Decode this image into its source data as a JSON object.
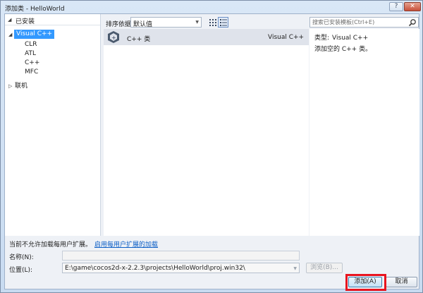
{
  "window": {
    "title": "添加类 - HelloWorld",
    "help_glyph": "?",
    "close_glyph": "✕"
  },
  "tree": {
    "installed_label": "已安装",
    "items": [
      "Visual C++",
      "CLR",
      "ATL",
      "C++",
      "MFC"
    ],
    "online_label": "联机"
  },
  "toolbar": {
    "sort_label": "排序依据:",
    "sort_value": "默认值"
  },
  "templates": [
    {
      "name": "C++ 类",
      "language": "Visual C++",
      "icon": "cpp-class-icon"
    }
  ],
  "search": {
    "placeholder": "搜索已安装模板(Ctrl+E)"
  },
  "details": {
    "type_label": "类型:",
    "type_value": "Visual C++",
    "description": "添加空的 C++ 类。"
  },
  "footer": {
    "status_text": "当前不允许加载每用户扩展。",
    "status_link": "启用每用户扩展的加载",
    "name_label": "名称(N):",
    "name_value": "",
    "location_label": "位置(L):",
    "location_value": "E:\\game\\cocos2d-x-2.2.3\\projects\\HelloWorld\\proj.win32\\",
    "browse_label": "浏览(B)...",
    "add_label": "添加(A)",
    "cancel_label": "取消"
  },
  "colors": {
    "selection": "#3399ff",
    "highlight": "#e8141f",
    "link": "#0b5ec6"
  }
}
